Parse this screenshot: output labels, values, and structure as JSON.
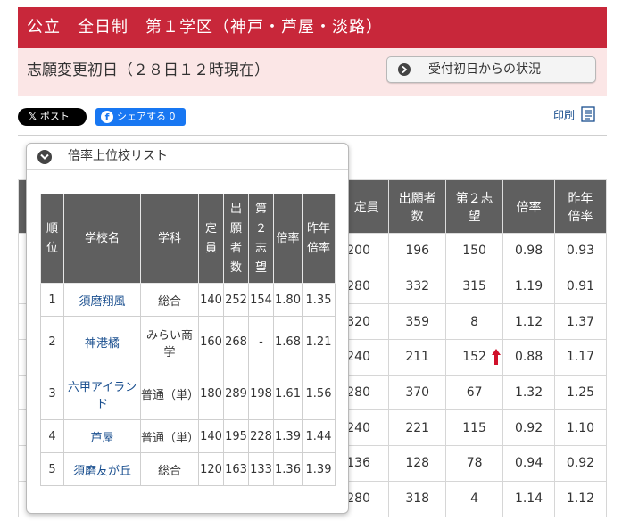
{
  "header": {
    "title": "公立　全日制　第１学区（神戸・芦屋・淡路）"
  },
  "subheader": {
    "title": "志願変更初日（２８日１２時現在）",
    "status_button": "受付初日からの状況"
  },
  "share": {
    "x_label": "ポスト",
    "fb_label": "シェアする 0",
    "print_label": "印刷"
  },
  "main_table": {
    "headers": [
      "定員",
      "出願者数",
      "第２志望",
      "倍率",
      "昨年倍率"
    ],
    "rows": [
      [
        "200",
        "196",
        "150",
        "0.98",
        "0.93"
      ],
      [
        "280",
        "332",
        "315",
        "1.19",
        "0.91"
      ],
      [
        "320",
        "359",
        "8",
        "1.12",
        "1.37"
      ],
      [
        "240",
        "211",
        "152",
        "0.88",
        "1.17"
      ],
      [
        "280",
        "370",
        "67",
        "1.32",
        "1.25"
      ],
      [
        "240",
        "221",
        "115",
        "0.92",
        "1.10"
      ],
      [
        "136",
        "128",
        "78",
        "0.94",
        "0.92"
      ],
      [
        "280",
        "318",
        "4",
        "1.14",
        "1.12"
      ]
    ],
    "up_arrow_color": "#d0102a"
  },
  "ranking": {
    "title": "倍率上位校リスト",
    "headers": [
      "順位",
      "学校名",
      "学科",
      "定員",
      "出願者数",
      "第２志望",
      "倍率",
      "昨年倍率"
    ],
    "rows": [
      {
        "rank": "1",
        "school": "須磨翔風",
        "dept": "総合",
        "cap": "140",
        "apps": "252",
        "second": "154",
        "ratio": "1.80",
        "last": "1.35"
      },
      {
        "rank": "2",
        "school": "神港橘",
        "dept": "みらい商学",
        "cap": "160",
        "apps": "268",
        "second": "-",
        "ratio": "1.68",
        "last": "1.21"
      },
      {
        "rank": "3",
        "school": "六甲アイランド",
        "dept": "普通（単）",
        "cap": "180",
        "apps": "289",
        "second": "198",
        "ratio": "1.61",
        "last": "1.56"
      },
      {
        "rank": "4",
        "school": "芦屋",
        "dept": "普通（単）",
        "cap": "140",
        "apps": "195",
        "second": "228",
        "ratio": "1.39",
        "last": "1.44"
      },
      {
        "rank": "5",
        "school": "須磨友が丘",
        "dept": "総合",
        "cap": "120",
        "apps": "163",
        "second": "133",
        "ratio": "1.36",
        "last": "1.39"
      }
    ]
  },
  "colors": {
    "header_red": "#c8273a",
    "sub_pink": "#fbe6e6",
    "table_header": "#5f5f5f",
    "link_blue": "#1a4f8f"
  }
}
